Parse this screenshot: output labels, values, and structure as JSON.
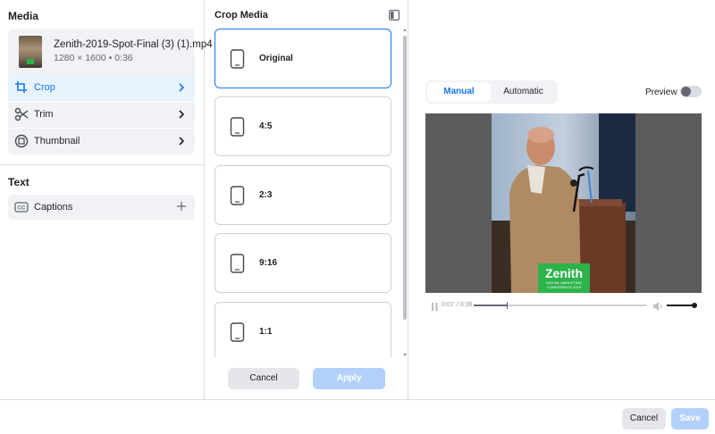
{
  "media": {
    "section_title": "Media",
    "file_name": "Zenith-2019-Spot-Final (3) (1).mp4",
    "file_meta": "1280 × 1600 • 0:36",
    "menu": [
      {
        "label": "Crop",
        "icon": "crop-icon",
        "active": true
      },
      {
        "label": "Trim",
        "icon": "scissors-icon",
        "active": false
      },
      {
        "label": "Thumbnail",
        "icon": "thumbnail-icon",
        "active": false
      }
    ]
  },
  "text_section": {
    "title": "Text",
    "captions_label": "Captions",
    "captions_icon": "cc-icon"
  },
  "crop": {
    "title": "Crop Media",
    "options": [
      {
        "label": "Original",
        "selected": true
      },
      {
        "label": "4:5",
        "selected": false
      },
      {
        "label": "2:3",
        "selected": false
      },
      {
        "label": "9:16",
        "selected": false
      },
      {
        "label": "1:1",
        "selected": false
      }
    ],
    "cancel_label": "Cancel",
    "apply_label": "Apply"
  },
  "preview": {
    "tabs": [
      "Manual",
      "Automatic"
    ],
    "active_tab": "Manual",
    "toggle_label": "Preview",
    "toggle_on": false,
    "logo_text": "Zenith",
    "logo_sub1": "DIGITAL MARKETING",
    "logo_sub2": "CONFERENCE 2019",
    "time_current": "0:07",
    "time_total": "/ 0:36",
    "progress": 0.194,
    "volume": 1.0
  },
  "footer": {
    "cancel_label": "Cancel",
    "save_label": "Save"
  },
  "colors": {
    "accent": "#1877f2",
    "disabled_blue": "#b3d0fb",
    "panel_grey": "#f0f2f5",
    "logo_green": "#2cb34a"
  }
}
